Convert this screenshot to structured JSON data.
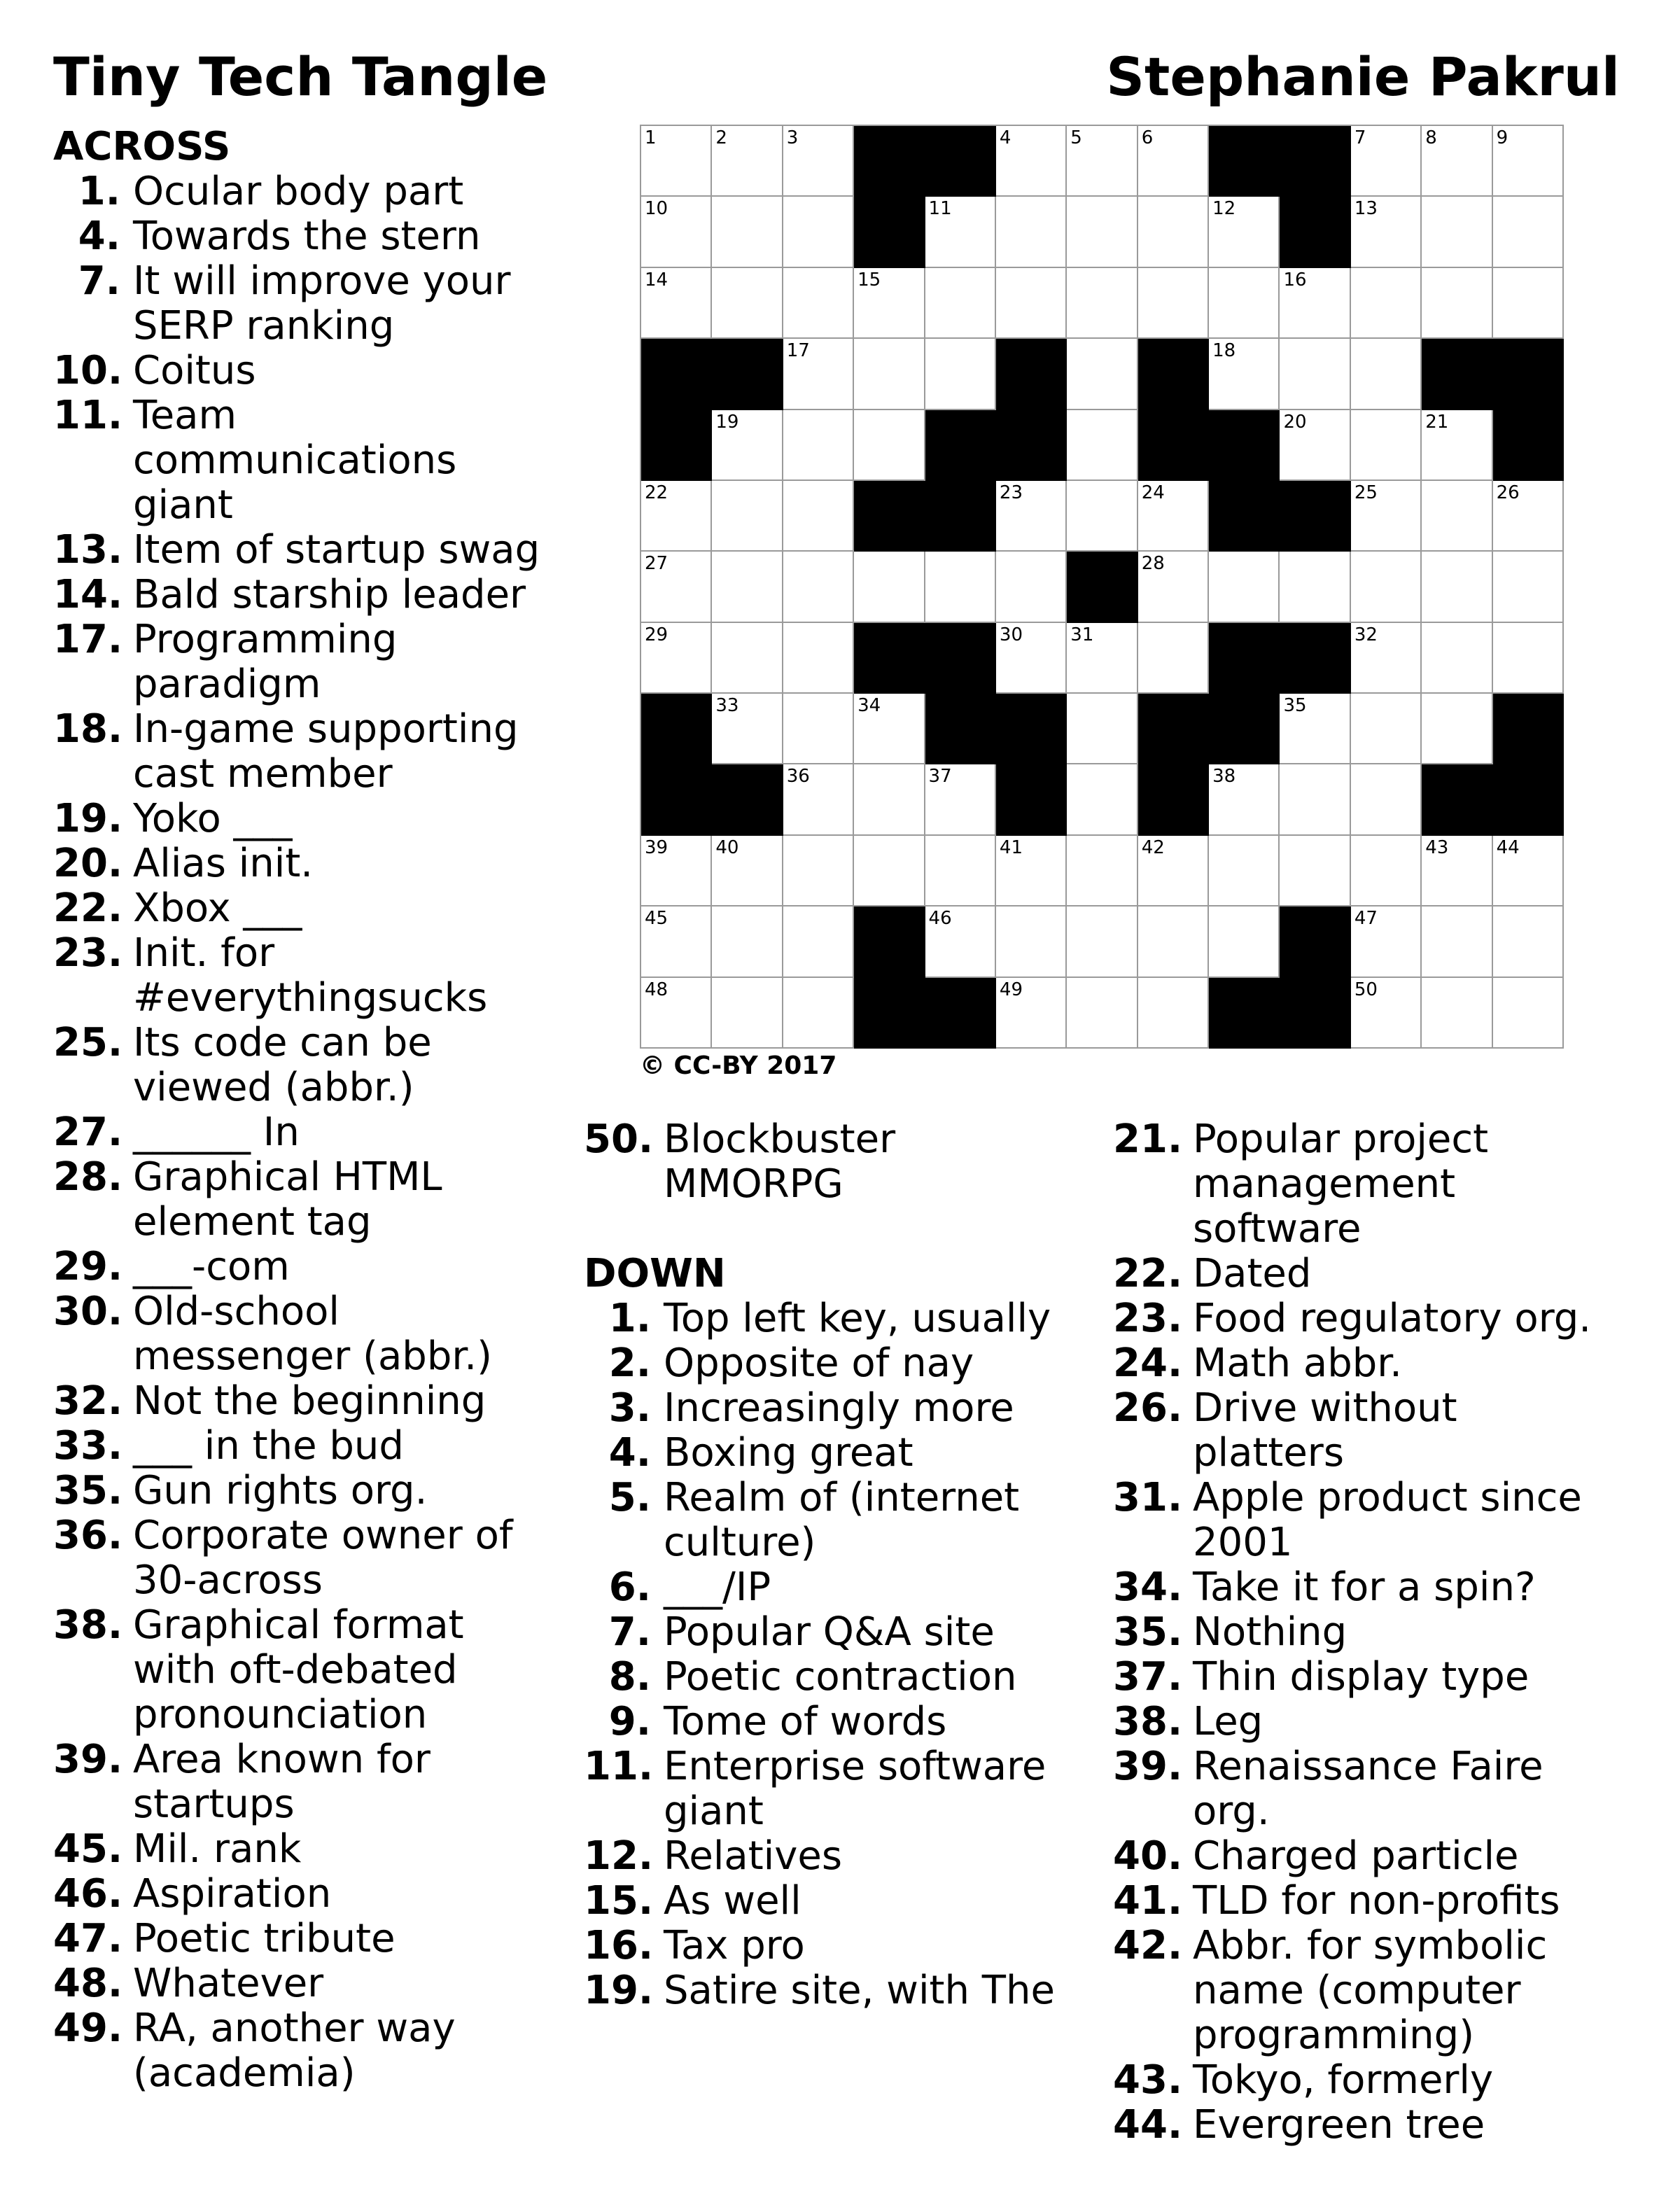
{
  "title": "Tiny Tech Tangle",
  "author": "Stephanie Pakrul",
  "copyright": "© CC-BY 2017",
  "across_heading": "ACROSS",
  "down_heading": "DOWN",
  "grid": {
    "rows": 13,
    "cols": 13,
    "blocks": [
      [
        0,
        3
      ],
      [
        0,
        4
      ],
      [
        0,
        8
      ],
      [
        0,
        9
      ],
      [
        1,
        3
      ],
      [
        1,
        9
      ],
      [
        3,
        0
      ],
      [
        3,
        1
      ],
      [
        3,
        5
      ],
      [
        3,
        7
      ],
      [
        3,
        11
      ],
      [
        3,
        12
      ],
      [
        4,
        0
      ],
      [
        4,
        4
      ],
      [
        4,
        5
      ],
      [
        4,
        7
      ],
      [
        4,
        8
      ],
      [
        4,
        12
      ],
      [
        5,
        3
      ],
      [
        5,
        4
      ],
      [
        5,
        8
      ],
      [
        5,
        9
      ],
      [
        6,
        6
      ],
      [
        7,
        3
      ],
      [
        7,
        4
      ],
      [
        7,
        8
      ],
      [
        7,
        9
      ],
      [
        8,
        0
      ],
      [
        8,
        4
      ],
      [
        8,
        5
      ],
      [
        8,
        7
      ],
      [
        8,
        8
      ],
      [
        8,
        12
      ],
      [
        9,
        0
      ],
      [
        9,
        1
      ],
      [
        9,
        5
      ],
      [
        9,
        7
      ],
      [
        9,
        11
      ],
      [
        9,
        12
      ],
      [
        11,
        3
      ],
      [
        11,
        9
      ],
      [
        12,
        3
      ],
      [
        12,
        4
      ],
      [
        12,
        8
      ],
      [
        12,
        9
      ]
    ],
    "numbers": [
      [
        0,
        0,
        "1"
      ],
      [
        0,
        1,
        "2"
      ],
      [
        0,
        2,
        "3"
      ],
      [
        0,
        5,
        "4"
      ],
      [
        0,
        6,
        "5"
      ],
      [
        0,
        7,
        "6"
      ],
      [
        0,
        10,
        "7"
      ],
      [
        0,
        11,
        "8"
      ],
      [
        0,
        12,
        "9"
      ],
      [
        1,
        0,
        "10"
      ],
      [
        1,
        4,
        "11"
      ],
      [
        1,
        8,
        "12"
      ],
      [
        1,
        10,
        "13"
      ],
      [
        2,
        0,
        "14"
      ],
      [
        2,
        3,
        "15"
      ],
      [
        2,
        9,
        "16"
      ],
      [
        3,
        2,
        "17"
      ],
      [
        3,
        8,
        "18"
      ],
      [
        4,
        1,
        "19"
      ],
      [
        4,
        9,
        "20"
      ],
      [
        4,
        11,
        "21"
      ],
      [
        5,
        0,
        "22"
      ],
      [
        5,
        5,
        "23"
      ],
      [
        5,
        7,
        "24"
      ],
      [
        5,
        10,
        "25"
      ],
      [
        5,
        12,
        "26"
      ],
      [
        6,
        0,
        "27"
      ],
      [
        6,
        7,
        "28"
      ],
      [
        7,
        0,
        "29"
      ],
      [
        7,
        5,
        "30"
      ],
      [
        7,
        6,
        "31"
      ],
      [
        7,
        10,
        "32"
      ],
      [
        8,
        1,
        "33"
      ],
      [
        8,
        3,
        "34"
      ],
      [
        8,
        9,
        "35"
      ],
      [
        9,
        2,
        "36"
      ],
      [
        9,
        4,
        "37"
      ],
      [
        9,
        8,
        "38"
      ],
      [
        10,
        0,
        "39"
      ],
      [
        10,
        1,
        "40"
      ],
      [
        10,
        5,
        "41"
      ],
      [
        10,
        7,
        "42"
      ],
      [
        10,
        11,
        "43"
      ],
      [
        10,
        12,
        "44"
      ],
      [
        11,
        0,
        "45"
      ],
      [
        11,
        4,
        "46"
      ],
      [
        11,
        10,
        "47"
      ],
      [
        12,
        0,
        "48"
      ],
      [
        12,
        5,
        "49"
      ],
      [
        12,
        10,
        "50"
      ]
    ]
  },
  "across_left": [
    {
      "num": "1.",
      "lines": [
        "Ocular body part"
      ]
    },
    {
      "num": "4.",
      "lines": [
        "Towards the stern"
      ]
    },
    {
      "num": "7.",
      "lines": [
        "It will improve your",
        "SERP ranking"
      ]
    },
    {
      "num": "10.",
      "lines": [
        "Coitus"
      ]
    },
    {
      "num": "11.",
      "lines": [
        "Team",
        "communications",
        "giant"
      ]
    },
    {
      "num": "13.",
      "lines": [
        "Item of startup swag"
      ]
    },
    {
      "num": "14.",
      "lines": [
        "Bald starship leader"
      ]
    },
    {
      "num": "17.",
      "lines": [
        "Programming",
        "paradigm"
      ]
    },
    {
      "num": "18.",
      "lines": [
        "In-game supporting",
        "cast member"
      ]
    },
    {
      "num": "19.",
      "lines": [
        "Yoko ___"
      ]
    },
    {
      "num": "20.",
      "lines": [
        "Alias init."
      ]
    },
    {
      "num": "22.",
      "lines": [
        "Xbox ___"
      ]
    },
    {
      "num": "23.",
      "lines": [
        "Init. for",
        "#everythingsucks"
      ]
    },
    {
      "num": "25.",
      "lines": [
        "Its code can be",
        "viewed (abbr.)"
      ]
    },
    {
      "num": "27.",
      "lines": [
        "______ In"
      ]
    },
    {
      "num": "28.",
      "lines": [
        "Graphical HTML",
        "element tag"
      ]
    },
    {
      "num": "29.",
      "lines": [
        "___-com"
      ]
    },
    {
      "num": "30.",
      "lines": [
        "Old-school",
        "messenger (abbr.)"
      ]
    },
    {
      "num": "32.",
      "lines": [
        "Not the beginning"
      ]
    },
    {
      "num": "33.",
      "lines": [
        "___ in the bud"
      ]
    },
    {
      "num": "35.",
      "lines": [
        "Gun rights org."
      ]
    },
    {
      "num": "36.",
      "lines": [
        "Corporate owner of",
        "30-across"
      ]
    },
    {
      "num": "38.",
      "lines": [
        "Graphical format",
        "with oft-debated",
        "pronounciation"
      ]
    },
    {
      "num": "39.",
      "lines": [
        "Area known for",
        "startups"
      ]
    },
    {
      "num": "45.",
      "lines": [
        "Mil. rank"
      ]
    },
    {
      "num": "46.",
      "lines": [
        "Aspiration"
      ]
    },
    {
      "num": "47.",
      "lines": [
        "Poetic tribute"
      ]
    },
    {
      "num": "48.",
      "lines": [
        "Whatever"
      ]
    },
    {
      "num": "49.",
      "lines": [
        "RA, another way",
        "(academia)"
      ]
    }
  ],
  "across_mid": [
    {
      "num": "50.",
      "lines": [
        "Blockbuster",
        "MMORPG"
      ]
    }
  ],
  "down_mid": [
    {
      "num": "1.",
      "lines": [
        "Top left key, usually"
      ]
    },
    {
      "num": "2.",
      "lines": [
        "Opposite of nay"
      ]
    },
    {
      "num": "3.",
      "lines": [
        "Increasingly more"
      ]
    },
    {
      "num": "4.",
      "lines": [
        "Boxing great"
      ]
    },
    {
      "num": "5.",
      "lines": [
        "Realm of (internet",
        "culture)"
      ]
    },
    {
      "num": "6.",
      "lines": [
        "___/IP"
      ]
    },
    {
      "num": "7.",
      "lines": [
        "Popular Q&A site"
      ]
    },
    {
      "num": "8.",
      "lines": [
        "Poetic contraction"
      ]
    },
    {
      "num": "9.",
      "lines": [
        "Tome of words"
      ]
    },
    {
      "num": "11.",
      "lines": [
        "Enterprise software",
        "giant"
      ]
    },
    {
      "num": "12.",
      "lines": [
        "Relatives"
      ]
    },
    {
      "num": "15.",
      "lines": [
        "As well"
      ]
    },
    {
      "num": "16.",
      "lines": [
        "Tax pro"
      ]
    },
    {
      "num": "19.",
      "lines": [
        "Satire site, with The"
      ]
    }
  ],
  "down_right": [
    {
      "num": "21.",
      "lines": [
        "Popular project",
        "management",
        "software"
      ]
    },
    {
      "num": "22.",
      "lines": [
        "Dated"
      ]
    },
    {
      "num": "23.",
      "lines": [
        "Food regulatory org."
      ]
    },
    {
      "num": "24.",
      "lines": [
        "Math abbr."
      ]
    },
    {
      "num": "26.",
      "lines": [
        "Drive without",
        "platters"
      ]
    },
    {
      "num": "31.",
      "lines": [
        "Apple product since",
        "2001"
      ]
    },
    {
      "num": "34.",
      "lines": [
        "Take it for a spin?"
      ]
    },
    {
      "num": "35.",
      "lines": [
        "Nothing"
      ]
    },
    {
      "num": "37.",
      "lines": [
        "Thin display type"
      ]
    },
    {
      "num": "38.",
      "lines": [
        "Leg"
      ]
    },
    {
      "num": "39.",
      "lines": [
        "Renaissance Faire",
        "org."
      ]
    },
    {
      "num": "40.",
      "lines": [
        "Charged particle"
      ]
    },
    {
      "num": "41.",
      "lines": [
        "TLD for non-profits"
      ]
    },
    {
      "num": "42.",
      "lines": [
        "Abbr. for symbolic",
        "name (computer",
        "programming)"
      ]
    },
    {
      "num": "43.",
      "lines": [
        "Tokyo, formerly"
      ]
    },
    {
      "num": "44.",
      "lines": [
        "Evergreen tree"
      ]
    }
  ]
}
